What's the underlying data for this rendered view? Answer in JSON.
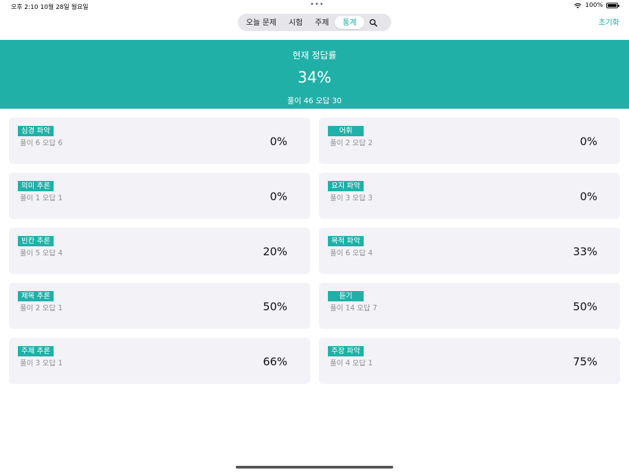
{
  "status": {
    "time": "오후 2:10   10월 28일 월요일",
    "battery": "100%"
  },
  "nav": {
    "tabs": [
      {
        "label": "오늘 문제"
      },
      {
        "label": "시험"
      },
      {
        "label": "주제"
      },
      {
        "label": "통계"
      }
    ],
    "active": "통계",
    "reset": "초기화"
  },
  "summary": {
    "title": "현재 정답률",
    "rate": "34%",
    "detail": "풀이 46 오답 30"
  },
  "colors": {
    "accent": "#20b0a8",
    "card_bg": "#f2f2f7"
  },
  "categories": [
    {
      "name": "심경 파악",
      "detail": "풀이 6 오답 6",
      "rate": "0%"
    },
    {
      "name": "어휘",
      "detail": "풀이 2 오답 2",
      "rate": "0%"
    },
    {
      "name": "의미 추론",
      "detail": "풀이 1 오답 1",
      "rate": "0%"
    },
    {
      "name": "요지 파악",
      "detail": "풀이 3 오답 3",
      "rate": "0%"
    },
    {
      "name": "빈칸 추론",
      "detail": "풀이 5 오답 4",
      "rate": "20%"
    },
    {
      "name": "목적 파악",
      "detail": "풀이 6 오답 4",
      "rate": "33%"
    },
    {
      "name": "제목 추론",
      "detail": "풀이 2 오답 1",
      "rate": "50%"
    },
    {
      "name": "듣기",
      "detail": "풀이 14 오답 7",
      "rate": "50%"
    },
    {
      "name": "주제 추론",
      "detail": "풀이 3 오답 1",
      "rate": "66%"
    },
    {
      "name": "주장 파악",
      "detail": "풀이 4 오답 1",
      "rate": "75%"
    }
  ]
}
